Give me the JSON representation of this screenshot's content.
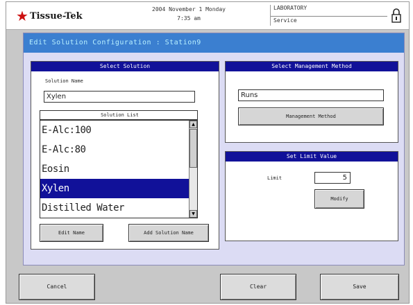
{
  "header": {
    "logo_text": "Tissue-Tek",
    "logo_star": "★",
    "date_line": "2004  November  1  Monday",
    "time_line": "7:35 am",
    "user_line1": "LABORATORY",
    "user_line2": "Service",
    "lock_icon": "lock-icon"
  },
  "main": {
    "title": "Edit Solution Configuration : Station9",
    "select_solution": {
      "title": "Select Solution",
      "name_label": "Solution Name",
      "name_value": "Xylen",
      "list_header": "Solution List",
      "items": [
        "E-Alc:100",
        "E-Alc:80",
        "Eosin",
        "Xylen",
        "Distilled Water"
      ],
      "selected_index": 3,
      "edit_button": "Edit Name",
      "add_button": "Add Solution Name"
    },
    "management": {
      "title": "Select Management Method",
      "value": "Runs",
      "button": "Management Method"
    },
    "limit": {
      "title": "Set Limit Value",
      "label": "Limit",
      "value": "5",
      "button": "Modify"
    }
  },
  "footer": {
    "cancel": "Cancel",
    "clear": "Clear",
    "save": "Save"
  },
  "colors": {
    "title_bar": "#3b7fd0",
    "panel_header": "#111199",
    "selected_row": "#111199",
    "main_bg": "#dcdcf4",
    "logo_star": "#cc1010"
  }
}
